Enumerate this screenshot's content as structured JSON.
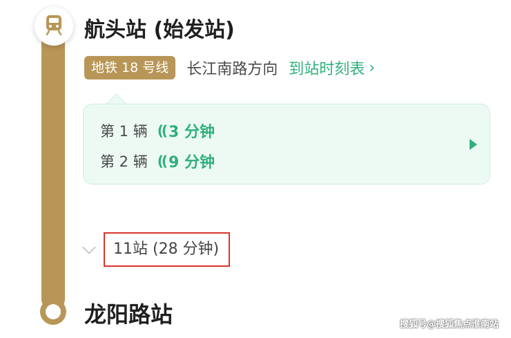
{
  "start_station": {
    "name": "航头站 (始发站)",
    "icon": "train-icon"
  },
  "line": {
    "badge": "地铁 18 号线",
    "direction": "长江南路方向",
    "timetable_link": "到站时刻表",
    "timetable_chevron": "›",
    "color": "#b89657"
  },
  "arrivals": [
    {
      "label": "第 1 辆",
      "signal": "((",
      "eta": "3 分钟"
    },
    {
      "label": "第 2 辆",
      "signal": "((",
      "eta": "9 分钟"
    }
  ],
  "accent_color": "#2fb07a",
  "stops_summary": "11站 (28 分钟)",
  "end_station": {
    "name": "龙阳路站"
  },
  "watermark": "搜狐号@搜狐焦点淮南站"
}
